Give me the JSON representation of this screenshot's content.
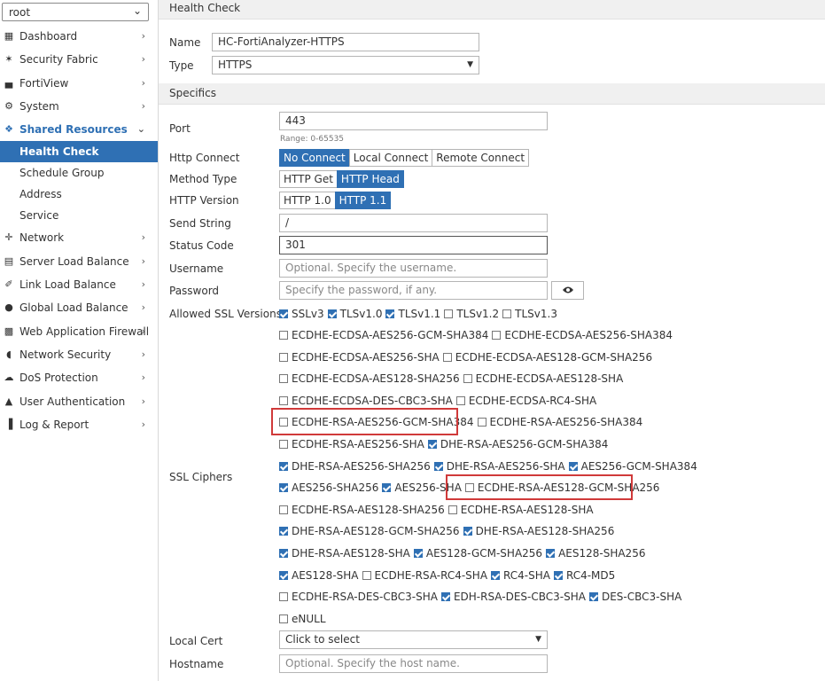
{
  "sidebar": {
    "vdom": "root",
    "items": [
      {
        "label": "Dashboard",
        "icon": "dashboard-icon"
      },
      {
        "label": "Security Fabric",
        "icon": "fabric-icon"
      },
      {
        "label": "FortiView",
        "icon": "chart-icon"
      },
      {
        "label": "System",
        "icon": "gear-icon"
      },
      {
        "label": "Shared Resources",
        "icon": "share-icon"
      }
    ],
    "sub_items": [
      "Health Check",
      "Schedule Group",
      "Address",
      "Service"
    ],
    "items_after": [
      {
        "label": "Network",
        "icon": "network-icon"
      },
      {
        "label": "Server Load Balance",
        "icon": "server-icon"
      },
      {
        "label": "Link Load Balance",
        "icon": "link-icon"
      },
      {
        "label": "Global Load Balance",
        "icon": "globe-icon"
      },
      {
        "label": "Web Application Firewall",
        "icon": "firewall-icon"
      },
      {
        "label": "Network Security",
        "icon": "shield-icon"
      },
      {
        "label": "DoS Protection",
        "icon": "cloud-icon"
      },
      {
        "label": "User Authentication",
        "icon": "user-icon"
      },
      {
        "label": "Log & Report",
        "icon": "report-icon"
      }
    ]
  },
  "main": {
    "header": "Health Check",
    "name_label": "Name",
    "name_value": "HC-FortiAnalyzer-HTTPS",
    "type_label": "Type",
    "type_value": "HTTPS",
    "specifics": "Specifics",
    "port_label": "Port",
    "port_value": "443",
    "port_range": "Range: 0-65535",
    "http_connect_label": "Http Connect",
    "http_connect_options": [
      "No Connect",
      "Local Connect",
      "Remote Connect"
    ],
    "method_label": "Method Type",
    "method_options": [
      "HTTP Get",
      "HTTP Head"
    ],
    "version_label": "HTTP Version",
    "version_options": [
      "HTTP 1.0",
      "HTTP 1.1"
    ],
    "send_label": "Send String",
    "send_value": "/",
    "status_label": "Status Code",
    "status_value": "301",
    "user_label": "Username",
    "user_placeholder": "Optional. Specify the username.",
    "pass_label": "Password",
    "pass_placeholder": "Specify the password, if any.",
    "ssl_versions_label": "Allowed SSL Versions",
    "ssl_versions": [
      {
        "label": "SSLv3",
        "checked": true
      },
      {
        "label": "TLSv1.0",
        "checked": true
      },
      {
        "label": "TLSv1.1",
        "checked": true
      },
      {
        "label": "TLSv1.2",
        "checked": false
      },
      {
        "label": "TLSv1.3",
        "checked": false
      }
    ],
    "ciphers_label": "SSL Ciphers",
    "cipher_rows": [
      [
        {
          "label": "ECDHE-ECDSA-AES256-GCM-SHA384",
          "checked": false
        },
        {
          "label": "ECDHE-ECDSA-AES256-SHA384",
          "checked": false
        }
      ],
      [
        {
          "label": "ECDHE-ECDSA-AES256-SHA",
          "checked": false
        },
        {
          "label": "ECDHE-ECDSA-AES128-GCM-SHA256",
          "checked": false
        }
      ],
      [
        {
          "label": "ECDHE-ECDSA-AES128-SHA256",
          "checked": false
        },
        {
          "label": "ECDHE-ECDSA-AES128-SHA",
          "checked": false
        }
      ],
      [
        {
          "label": "ECDHE-ECDSA-DES-CBC3-SHA",
          "checked": false
        },
        {
          "label": "ECDHE-ECDSA-RC4-SHA",
          "checked": false
        }
      ],
      [
        {
          "label": "ECDHE-RSA-AES256-GCM-SHA384",
          "checked": false
        },
        {
          "label": "ECDHE-RSA-AES256-SHA384",
          "checked": false
        }
      ],
      [
        {
          "label": "ECDHE-RSA-AES256-SHA",
          "checked": false
        },
        {
          "label": "DHE-RSA-AES256-GCM-SHA384",
          "checked": true
        }
      ],
      [
        {
          "label": "DHE-RSA-AES256-SHA256",
          "checked": true
        },
        {
          "label": "DHE-RSA-AES256-SHA",
          "checked": true
        },
        {
          "label": "AES256-GCM-SHA384",
          "checked": true
        }
      ],
      [
        {
          "label": "AES256-SHA256",
          "checked": true
        },
        {
          "label": "AES256-SHA",
          "checked": true
        },
        {
          "label": "ECDHE-RSA-AES128-GCM-SHA256",
          "checked": false
        }
      ],
      [
        {
          "label": "ECDHE-RSA-AES128-SHA256",
          "checked": false
        },
        {
          "label": "ECDHE-RSA-AES128-SHA",
          "checked": false
        }
      ],
      [
        {
          "label": "DHE-RSA-AES128-GCM-SHA256",
          "checked": true
        },
        {
          "label": "DHE-RSA-AES128-SHA256",
          "checked": true
        }
      ],
      [
        {
          "label": "DHE-RSA-AES128-SHA",
          "checked": true
        },
        {
          "label": "AES128-GCM-SHA256",
          "checked": true
        },
        {
          "label": "AES128-SHA256",
          "checked": true
        }
      ],
      [
        {
          "label": "AES128-SHA",
          "checked": true
        },
        {
          "label": "ECDHE-RSA-RC4-SHA",
          "checked": false
        },
        {
          "label": "RC4-SHA",
          "checked": true
        },
        {
          "label": "RC4-MD5",
          "checked": true
        }
      ],
      [
        {
          "label": "ECDHE-RSA-DES-CBC3-SHA",
          "checked": false
        },
        {
          "label": "EDH-RSA-DES-CBC3-SHA",
          "checked": true
        },
        {
          "label": "DES-CBC3-SHA",
          "checked": true
        }
      ],
      [
        {
          "label": "eNULL",
          "checked": false
        }
      ]
    ],
    "local_cert_label": "Local Cert",
    "local_cert_value": "Click to select",
    "hostname_label": "Hostname",
    "hostname_placeholder": "Optional. Specify the host name."
  },
  "colors": {
    "accent": "#2f70b4",
    "highlight": "#d03a3a"
  }
}
